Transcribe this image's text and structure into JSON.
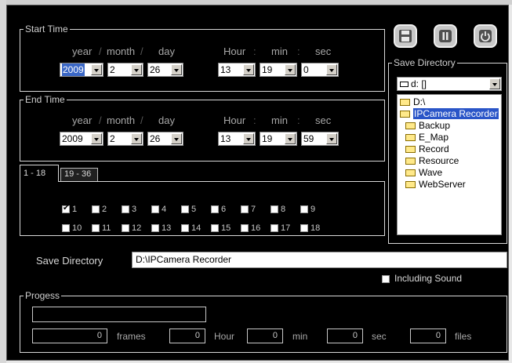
{
  "start_time": {
    "title": "Start Time",
    "headers": {
      "year": "year",
      "month": "month",
      "day": "day",
      "hour": "Hour",
      "min": "min",
      "sec": "sec"
    },
    "separators": {
      "date": "/",
      "time": ":"
    },
    "values": {
      "year": "2009",
      "month": "2",
      "day": "26",
      "hour": "13",
      "min": "19",
      "sec": "0"
    }
  },
  "end_time": {
    "title": "End Time",
    "headers": {
      "year": "year",
      "month": "month",
      "day": "day",
      "hour": "Hour",
      "min": "min",
      "sec": "sec"
    },
    "separators": {
      "date": "/",
      "time": ":"
    },
    "values": {
      "year": "2009",
      "month": "2",
      "day": "26",
      "hour": "13",
      "min": "19",
      "sec": "59"
    }
  },
  "tabs": [
    {
      "label": "1 - 18"
    },
    {
      "label": "19 - 36"
    }
  ],
  "channels": [
    {
      "label": "1",
      "checked": true
    },
    {
      "label": "2",
      "checked": false
    },
    {
      "label": "3",
      "checked": false
    },
    {
      "label": "4",
      "checked": false
    },
    {
      "label": "5",
      "checked": false
    },
    {
      "label": "6",
      "checked": false
    },
    {
      "label": "7",
      "checked": false
    },
    {
      "label": "8",
      "checked": false
    },
    {
      "label": "9",
      "checked": false
    },
    {
      "label": "10",
      "checked": false
    },
    {
      "label": "11",
      "checked": false
    },
    {
      "label": "12",
      "checked": false
    },
    {
      "label": "13",
      "checked": false
    },
    {
      "label": "14",
      "checked": false
    },
    {
      "label": "15",
      "checked": false
    },
    {
      "label": "16",
      "checked": false
    },
    {
      "label": "17",
      "checked": false
    },
    {
      "label": "18",
      "checked": false
    }
  ],
  "save_panel": {
    "title": "Save Directory",
    "drive": "d: []",
    "tree": [
      {
        "label": "D:\\",
        "selected": false
      },
      {
        "label": "IPCamera Recorder",
        "selected": true
      },
      {
        "label": "Backup",
        "selected": false
      },
      {
        "label": "E_Map",
        "selected": false
      },
      {
        "label": "Record",
        "selected": false
      },
      {
        "label": "Resource",
        "selected": false
      },
      {
        "label": "Wave",
        "selected": false
      },
      {
        "label": "WebServer",
        "selected": false
      }
    ]
  },
  "toolbar": {
    "save_icon": "floppy-disk-icon",
    "pause_icon": "pause-icon",
    "power_icon": "power-icon"
  },
  "save_directory": {
    "label": "Save Directory",
    "value": "D:\\IPCamera Recorder"
  },
  "including_sound": {
    "label": "Including Sound",
    "checked": false
  },
  "progress": {
    "title": "Progess",
    "bar_fraction": 0,
    "frames": "0",
    "frames_label": "frames",
    "hour": "0",
    "hour_label": "Hour",
    "min": "0",
    "min_label": "min",
    "sec": "0",
    "sec_label": "sec",
    "files": "0",
    "files_label": "files"
  },
  "colors": {
    "background": "#000000",
    "text": "#c8c8c8",
    "selection": "#2a55c8"
  }
}
